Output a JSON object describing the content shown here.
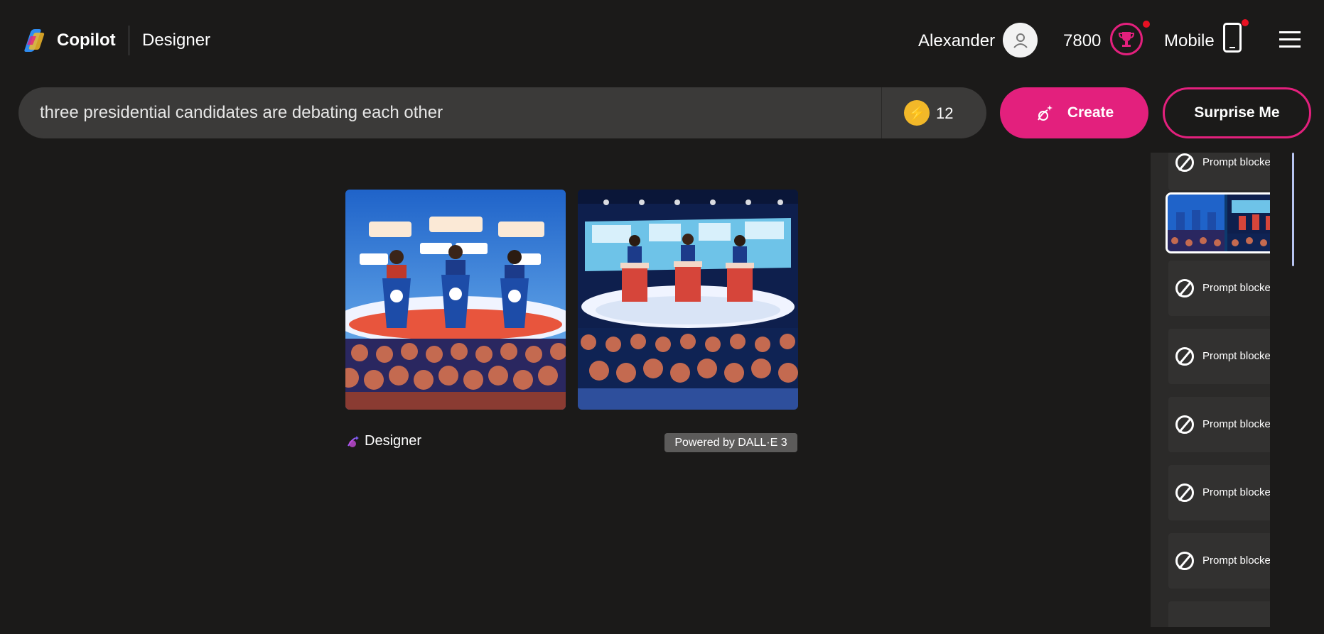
{
  "header": {
    "brand": "Copilot",
    "product": "Designer",
    "user_name": "Alexander",
    "points": "7800",
    "mobile_label": "Mobile"
  },
  "prompt": {
    "value": "three presidential candidates are debating each other",
    "boost_count": "12"
  },
  "actions": {
    "create_label": "Create",
    "surprise_label": "Surprise Me"
  },
  "results": {
    "footer_brand": "Designer",
    "powered_by": "Powered by DALL·E 3"
  },
  "history": {
    "items": [
      {
        "label": "Prompt blocked"
      },
      {
        "label": "Prompt blocked"
      },
      {
        "label": "Prompt blocked"
      },
      {
        "label": "Prompt blocked"
      },
      {
        "label": "Prompt blocked"
      },
      {
        "label": "Prompt blocked"
      }
    ]
  },
  "colors": {
    "accent": "#e3207d",
    "background": "#1b1a19",
    "boost": "#f2b829"
  }
}
